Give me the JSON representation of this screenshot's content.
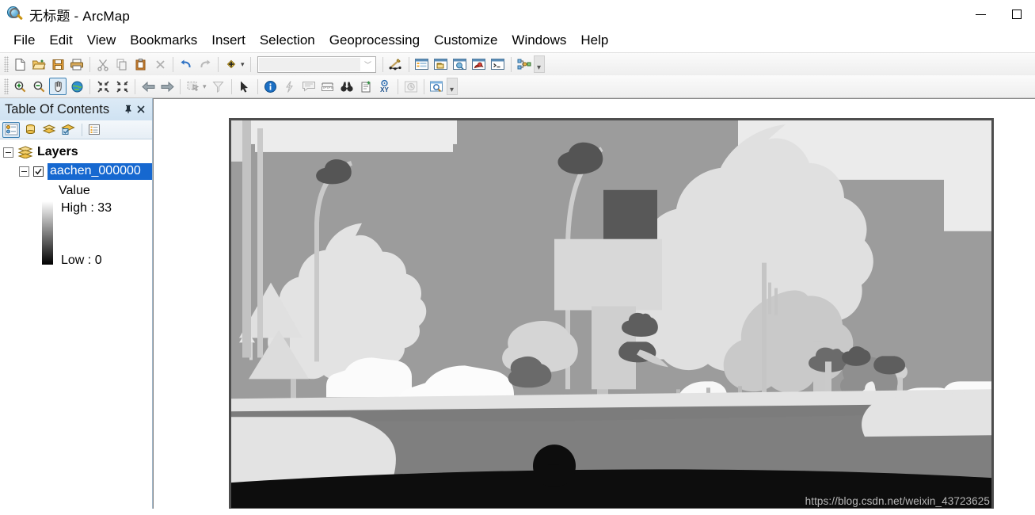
{
  "window": {
    "title": "无标题 - ArcMap",
    "app_icon": "arcmap-globe-magnifier-icon",
    "minimize_label": "Minimize",
    "maximize_label": "Maximize"
  },
  "menubar": {
    "items": [
      {
        "label": "File"
      },
      {
        "label": "Edit"
      },
      {
        "label": "View"
      },
      {
        "label": "Bookmarks"
      },
      {
        "label": "Insert"
      },
      {
        "label": "Selection"
      },
      {
        "label": "Geoprocessing"
      },
      {
        "label": "Customize"
      },
      {
        "label": "Windows"
      },
      {
        "label": "Help"
      }
    ]
  },
  "standard_toolbar": {
    "buttons": [
      {
        "name": "new-map-icon",
        "tooltip": "New"
      },
      {
        "name": "open-folder-icon",
        "tooltip": "Open"
      },
      {
        "name": "save-icon",
        "tooltip": "Save"
      },
      {
        "name": "print-icon",
        "tooltip": "Print"
      },
      {
        "name": "cut-scissors-icon",
        "tooltip": "Cut"
      },
      {
        "name": "copy-icon",
        "tooltip": "Copy"
      },
      {
        "name": "paste-clipboard-icon",
        "tooltip": "Paste"
      },
      {
        "name": "delete-x-icon",
        "tooltip": "Delete"
      },
      {
        "name": "undo-arrow-icon",
        "tooltip": "Undo"
      },
      {
        "name": "redo-arrow-icon",
        "tooltip": "Redo"
      },
      {
        "name": "add-data-icon",
        "tooltip": "Add Data"
      },
      {
        "name": "editor-toolbar-icon",
        "tooltip": "Editor Toolbar"
      },
      {
        "name": "table-of-contents-icon",
        "tooltip": "Table Of Contents"
      },
      {
        "name": "catalog-window-icon",
        "tooltip": "Catalog"
      },
      {
        "name": "search-window-icon",
        "tooltip": "Search"
      },
      {
        "name": "arctoolbox-icon",
        "tooltip": "ArcToolbox"
      },
      {
        "name": "python-window-icon",
        "tooltip": "Python Window"
      },
      {
        "name": "model-builder-icon",
        "tooltip": "ModelBuilder"
      }
    ],
    "scale_combo": {
      "value": "",
      "placeholder": ""
    }
  },
  "tools_toolbar": {
    "buttons": [
      {
        "name": "zoom-in-icon",
        "tooltip": "Zoom In"
      },
      {
        "name": "zoom-out-icon",
        "tooltip": "Zoom Out"
      },
      {
        "name": "pan-hand-icon",
        "tooltip": "Pan",
        "active": true
      },
      {
        "name": "full-extent-globe-icon",
        "tooltip": "Full Extent"
      },
      {
        "name": "fixed-zoom-in-icon",
        "tooltip": "Fixed Zoom In"
      },
      {
        "name": "fixed-zoom-out-icon",
        "tooltip": "Fixed Zoom Out"
      },
      {
        "name": "go-back-extent-icon",
        "tooltip": "Go Back To Previous Extent"
      },
      {
        "name": "go-next-extent-icon",
        "tooltip": "Go To Next Extent"
      },
      {
        "name": "select-features-icon",
        "tooltip": "Select Features"
      },
      {
        "name": "clear-selection-icon",
        "tooltip": "Clear Selected Features"
      },
      {
        "name": "select-elements-arrow-icon",
        "tooltip": "Select Elements"
      },
      {
        "name": "identify-info-icon",
        "tooltip": "Identify"
      },
      {
        "name": "hyperlink-lightning-icon",
        "tooltip": "Hyperlink"
      },
      {
        "name": "html-popup-icon",
        "tooltip": "HTML Popup"
      },
      {
        "name": "measure-ruler-icon",
        "tooltip": "Measure"
      },
      {
        "name": "find-binoculars-icon",
        "tooltip": "Find"
      },
      {
        "name": "find-route-icon",
        "tooltip": "Find Route"
      },
      {
        "name": "go-to-xy-icon",
        "tooltip": "Go To XY"
      },
      {
        "name": "time-slider-icon",
        "tooltip": "Time Slider"
      },
      {
        "name": "create-viewer-window-icon",
        "tooltip": "Create Viewer Window"
      }
    ]
  },
  "toc": {
    "title": "Table Of Contents",
    "pin_icon": "pin-icon",
    "close_icon": "close-icon",
    "toolbar": [
      {
        "name": "list-by-drawing-order-icon",
        "label": "List By Drawing Order",
        "active": true
      },
      {
        "name": "list-by-source-icon",
        "label": "List By Source",
        "active": false
      },
      {
        "name": "list-by-visibility-icon",
        "label": "List By Visibility",
        "active": false
      },
      {
        "name": "list-by-selection-icon",
        "label": "List By Selection",
        "active": false
      },
      {
        "name": "toc-options-icon",
        "label": "Options",
        "active": false
      }
    ],
    "tree": {
      "root_label": "Layers",
      "layer_name": "aachen_000000",
      "layer_checked": true,
      "legend": {
        "field_label": "Value",
        "high_label": "High : 33",
        "low_label": "Low : 0",
        "ramp_top_color": "#ffffff",
        "ramp_bottom_color": "#000000"
      }
    }
  },
  "map": {
    "background_color": "#ffffff",
    "raster_border_color": "#4d4d4d",
    "watermark": "https://blog.csdn.net/weixin_43723625",
    "palette": {
      "sky": "#9c9c9c",
      "building": "#e8e8e8",
      "road": "#7f7f7f",
      "sidewalk": "#e3e3e3",
      "vegetation": "#dddddd",
      "vegetation_dark": "#b7b7b7",
      "car": "#fbfbfb",
      "pole": "#c5c5c5",
      "traffic_sign": "#dcdcdc",
      "traffic_light": "#5a5a5a",
      "person": "#efefef",
      "ego_vehicle": "#0d0d0d",
      "terrain": "#6f6f6f"
    }
  }
}
